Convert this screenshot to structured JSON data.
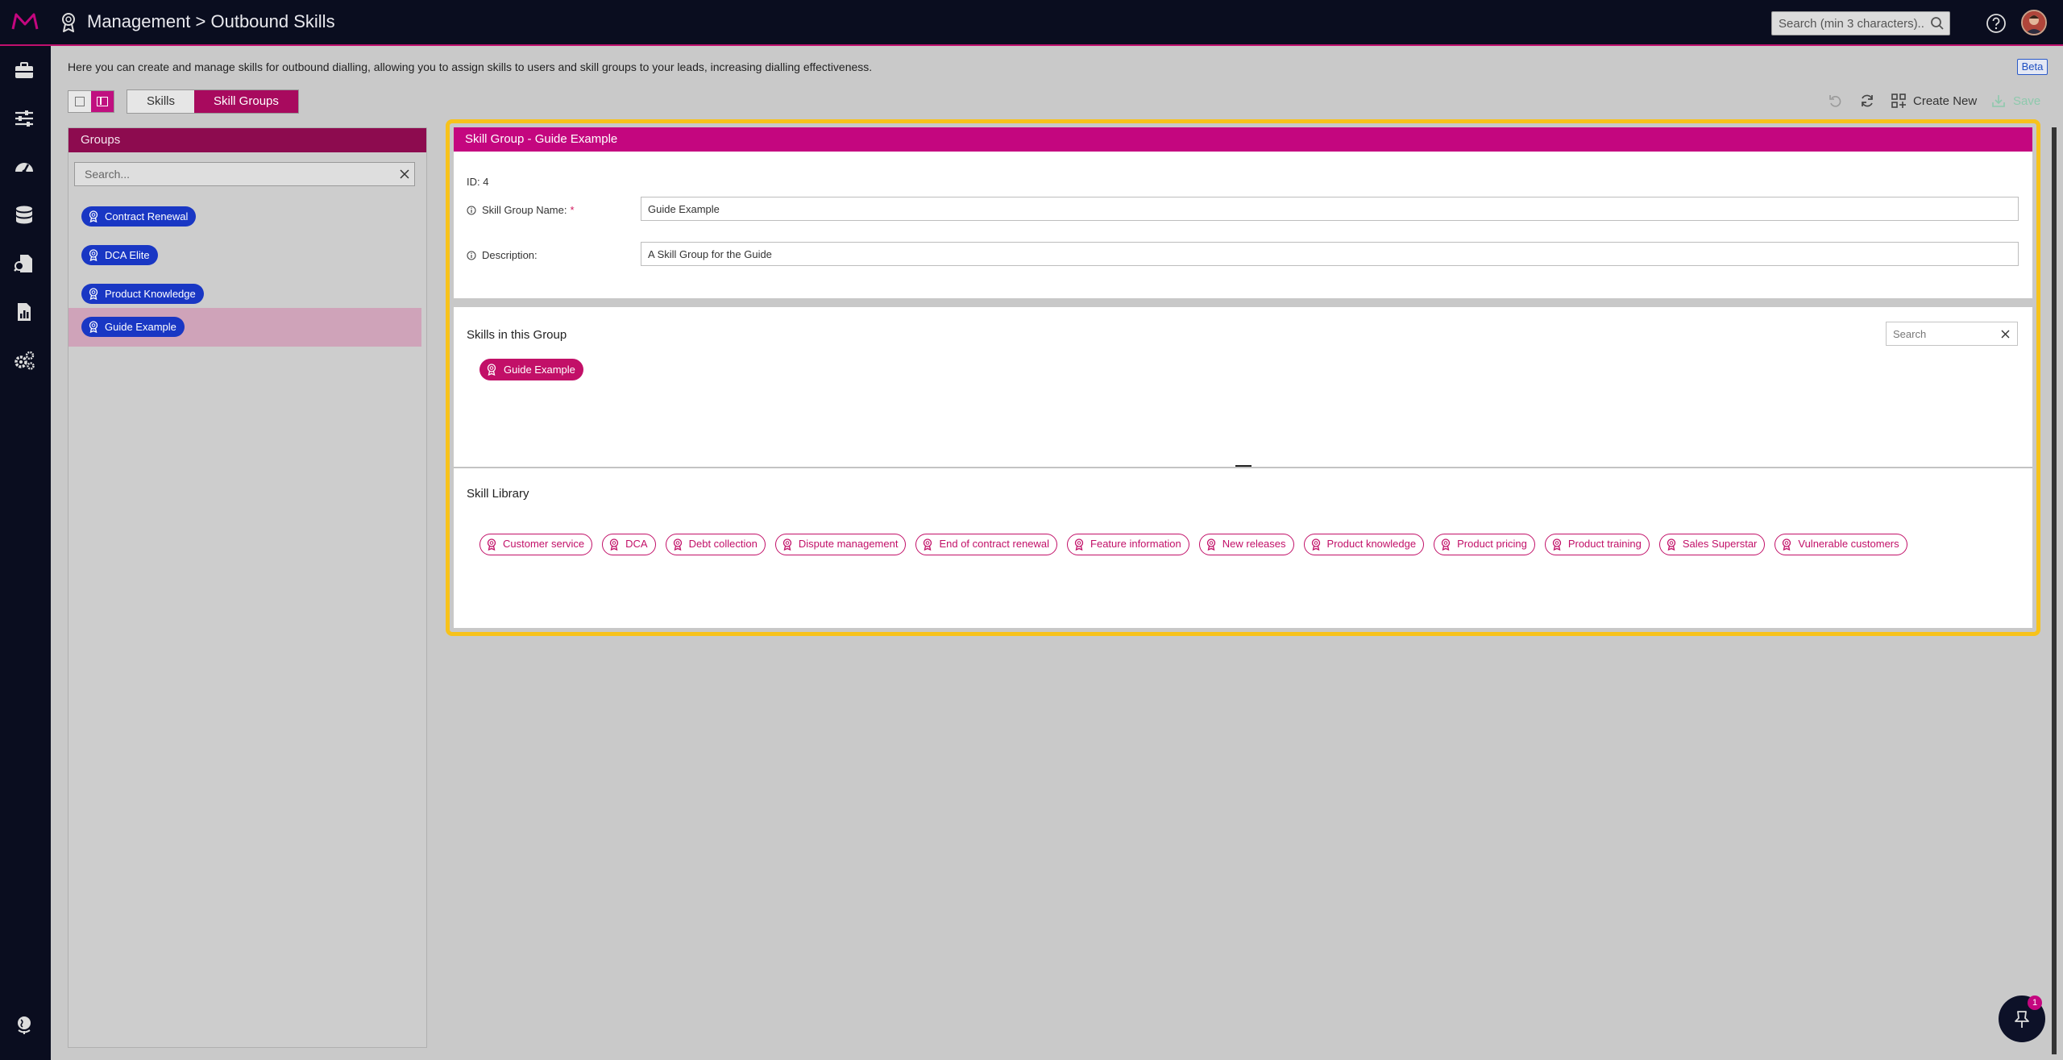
{
  "header": {
    "title": "Management > Outbound Skills",
    "search_placeholder": "Search (min 3 characters)..."
  },
  "description": "Here you can create and manage skills for outbound dialling, allowing you to assign skills to users and skill groups to your leads, increasing dialling effectiveness.",
  "beta_label": "Beta",
  "tabs": [
    {
      "label": "Skills",
      "active": false
    },
    {
      "label": "Skill Groups",
      "active": true
    }
  ],
  "toolbar": {
    "create_label": "Create New",
    "save_label": "Save"
  },
  "groups": {
    "header": "Groups",
    "search_placeholder": "Search...",
    "items": [
      {
        "label": "Contract Renewal"
      },
      {
        "label": "DCA Elite"
      },
      {
        "label": "Product Knowledge"
      },
      {
        "label": "Guide Example",
        "selected": true
      }
    ]
  },
  "detail": {
    "header": "Skill Group - Guide Example",
    "id_label": "ID: 4",
    "name_label": "Skill Group Name:",
    "name_value": "Guide Example",
    "description_label": "Description:",
    "description_value": "A Skill Group for the Guide",
    "skills_title": "Skills in this Group",
    "skills_search_placeholder": "Search",
    "skills_in_group": [
      "Guide Example"
    ],
    "library_title": "Skill Library",
    "library": [
      "Customer service",
      "DCA",
      "Debt collection",
      "Dispute management",
      "End of contract renewal",
      "Feature information",
      "New releases",
      "Product knowledge",
      "Product pricing",
      "Product training",
      "Sales Superstar",
      "Vulnerable customers"
    ]
  },
  "pin_badge": "1",
  "colors": {
    "accent": "#c4067f",
    "group_chip": "#1937c4",
    "highlight": "#f7c21b"
  }
}
